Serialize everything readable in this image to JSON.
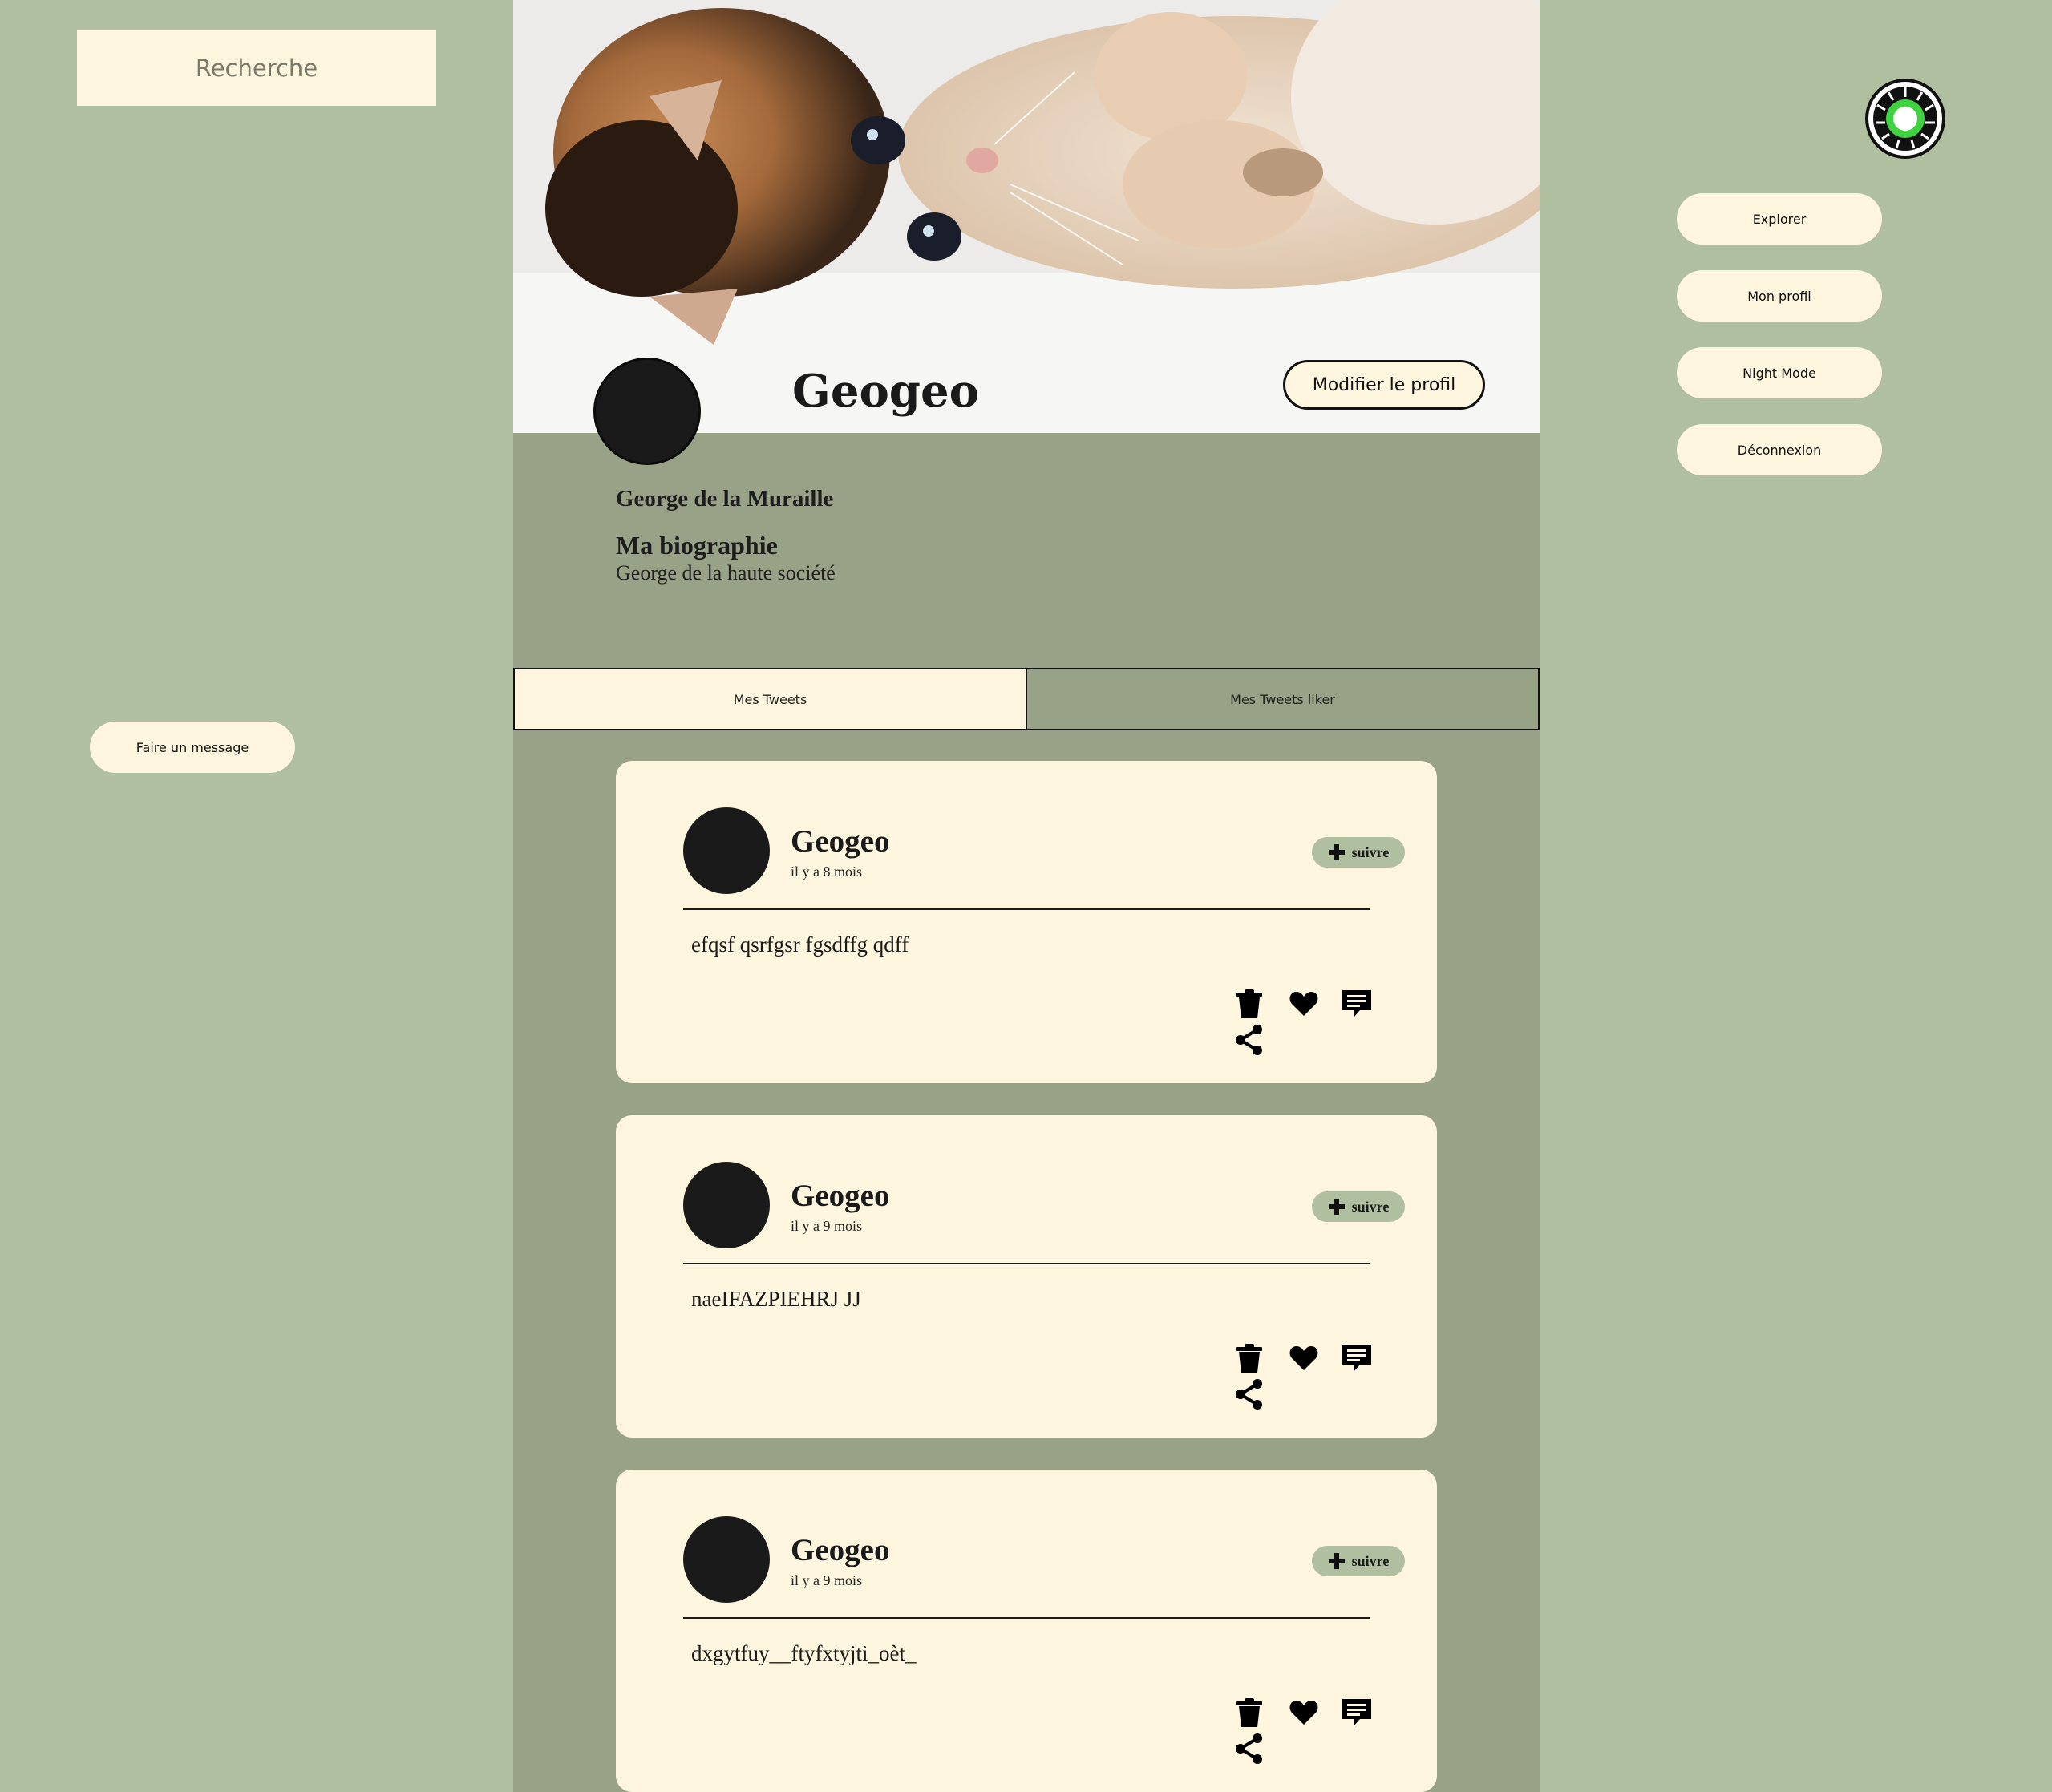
{
  "search": {
    "label": "Recherche"
  },
  "left_nav": {
    "message_button": "Faire un message"
  },
  "right_nav": {
    "items": [
      {
        "label": "Explorer"
      },
      {
        "label": "Mon profil"
      },
      {
        "label": "Night Mode"
      },
      {
        "label": "Déconnexion"
      }
    ]
  },
  "profile": {
    "username": "Geogeo",
    "edit_button": "Modifier le profil",
    "full_name": "George de la Muraille",
    "bio_title": "Ma biographie",
    "bio_text": "George de la haute société"
  },
  "tabs": [
    {
      "label": "Mes Tweets",
      "active": true
    },
    {
      "label": "Mes Tweets liker",
      "active": false
    }
  ],
  "tweets": [
    {
      "author": "Geogeo",
      "time": "il y a 8 mois",
      "follow_label": "suivre",
      "content": "efqsf qsrfgsr fgsdffg qdff"
    },
    {
      "author": "Geogeo",
      "time": "il y a 9 mois",
      "follow_label": "suivre",
      "content": "naeIFAZPIEHRJ JJ"
    },
    {
      "author": "Geogeo",
      "time": "il y a 9 mois",
      "follow_label": "suivre",
      "content": "dxgytfuy__ftyfxtyjti_oèt_"
    }
  ],
  "colors": {
    "page_bg": "#b0bf9f",
    "center_bg": "#97a287",
    "card_bg": "#fdf5dd",
    "logo_green": "#3fd13f"
  },
  "icons": {
    "tweet_actions": [
      "trash-icon",
      "heart-icon",
      "comment-icon",
      "share-icon"
    ],
    "follow": "plus-icon"
  }
}
